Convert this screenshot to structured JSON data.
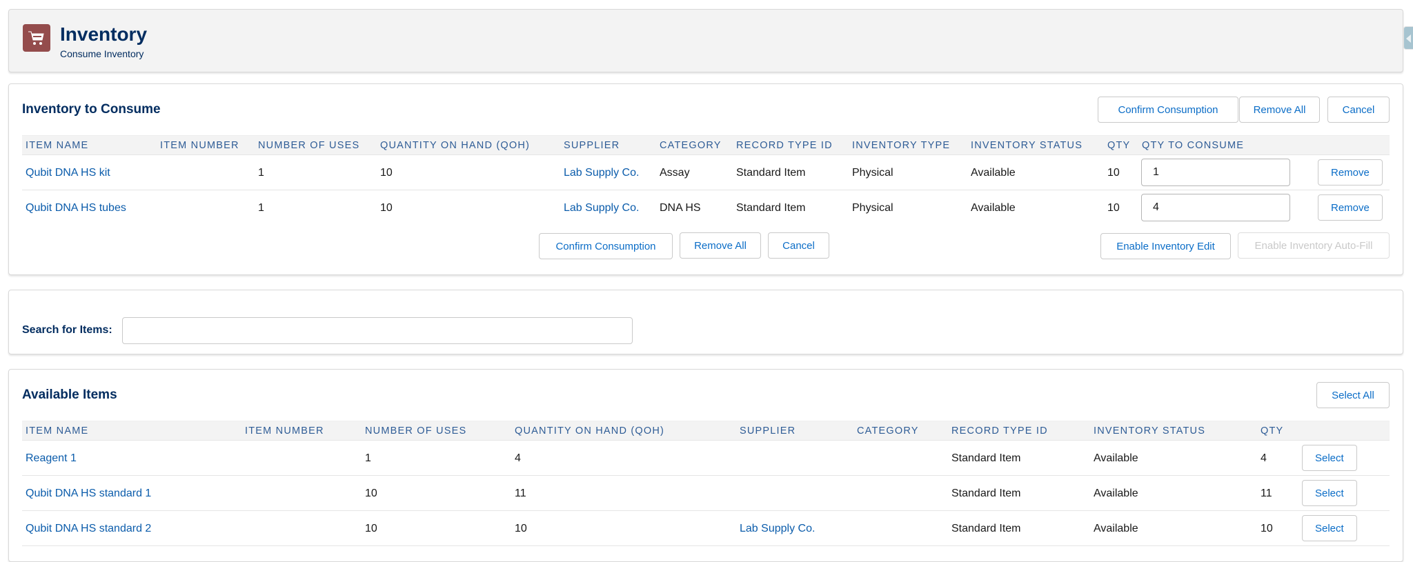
{
  "header": {
    "icon": "shopping-cart-icon",
    "title": "Inventory",
    "subtitle": "Consume Inventory",
    "icon_color": "#944c4c"
  },
  "consume": {
    "title": "Inventory to Consume",
    "top_buttons": {
      "confirm": "Confirm Consumption",
      "remove_all": "Remove All",
      "cancel": "Cancel"
    },
    "columns": [
      "Item Name",
      "Item Number",
      "Number of Uses",
      "Quantity On Hand (QOH)",
      "Supplier",
      "Category",
      "Record Type ID",
      "Inventory Type",
      "Inventory Status",
      "QTY",
      "QTY to Consume"
    ],
    "rows": [
      {
        "item_name": "Qubit DNA HS kit",
        "item_number": "",
        "uses": "1",
        "qoh": "10",
        "supplier": "Lab Supply Co.",
        "category": "Assay",
        "record_type": "Standard Item",
        "inventory_type": "Physical",
        "status": "Available",
        "qty": "10",
        "qty_to_consume": "1",
        "action": "Remove"
      },
      {
        "item_name": "Qubit DNA HS tubes",
        "item_number": "",
        "uses": "1",
        "qoh": "10",
        "supplier": "Lab Supply Co.",
        "category": "DNA HS",
        "record_type": "Standard Item",
        "inventory_type": "Physical",
        "status": "Available",
        "qty": "10",
        "qty_to_consume": "4",
        "action": "Remove"
      }
    ],
    "bottom_buttons": {
      "confirm": "Confirm Consumption",
      "remove_all": "Remove All",
      "cancel": "Cancel",
      "enable_edit": "Enable Inventory Edit",
      "enable_autofill": "Enable Inventory Auto-Fill"
    }
  },
  "search": {
    "label": "Search for Items:",
    "value": "",
    "placeholder": ""
  },
  "available": {
    "title": "Available Items",
    "select_all": "Select All",
    "columns": [
      "Item Name",
      "Item Number",
      "Number of Uses",
      "Quantity On Hand (QOH)",
      "Supplier",
      "Category",
      "Record Type ID",
      "Inventory Status",
      "QTY"
    ],
    "rows": [
      {
        "item_name": "Reagent 1",
        "item_number": "",
        "uses": "1",
        "qoh": "4",
        "supplier": "",
        "category": "",
        "record_type": "Standard Item",
        "status": "Available",
        "qty": "4",
        "action": "Select"
      },
      {
        "item_name": "Qubit DNA HS standard 1",
        "item_number": "",
        "uses": "10",
        "qoh": "11",
        "supplier": "",
        "category": "",
        "record_type": "Standard Item",
        "status": "Available",
        "qty": "11",
        "action": "Select"
      },
      {
        "item_name": "Qubit DNA HS standard 2",
        "item_number": "",
        "uses": "10",
        "qoh": "10",
        "supplier": "Lab Supply Co.",
        "category": "",
        "record_type": "Standard Item",
        "status": "Available",
        "qty": "10",
        "action": "Select"
      }
    ]
  },
  "colors": {
    "brand_navy": "#032d60",
    "link_blue": "#0b5cab",
    "button_blue": "#0b6dc7",
    "header_bg": "#f3f3f3"
  }
}
